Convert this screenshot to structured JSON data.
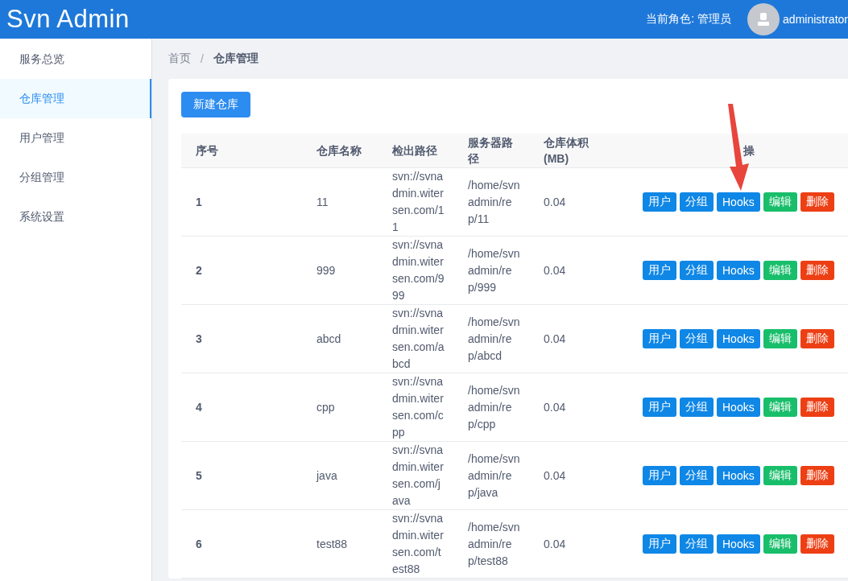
{
  "header": {
    "logo": "Svn Admin",
    "role_label": "当前角色:",
    "role": "管理员",
    "username": "administrator"
  },
  "sidebar": {
    "items": [
      {
        "label": "服务总览",
        "selected": false
      },
      {
        "label": "仓库管理",
        "selected": true
      },
      {
        "label": "用户管理",
        "selected": false
      },
      {
        "label": "分组管理",
        "selected": false
      },
      {
        "label": "系统设置",
        "selected": false
      }
    ]
  },
  "breadcrumb": [
    "首页",
    "/",
    "仓库管理"
  ],
  "new_button": "新建仓库",
  "table": {
    "columns": [
      "序号",
      "仓库名称",
      "检出路径",
      "服务器路径",
      "仓库体积 (MB)",
      "操"
    ],
    "rows": [
      {
        "index": "1",
        "name": "11",
        "checkout": "svn://svnadmin.witersen.com/11",
        "server_path": "/home/svnadmin/rep/11",
        "size": "0.04",
        "actions": [
          {
            "label": "用户",
            "kind": "primary"
          },
          {
            "label": "分组",
            "kind": "primary"
          },
          {
            "label": "Hooks",
            "kind": "primary"
          },
          {
            "label": "编辑",
            "kind": "success"
          },
          {
            "label": "删除",
            "kind": "danger"
          }
        ]
      },
      {
        "index": "2",
        "name": "999",
        "checkout": "svn://svnadmin.witersen.com/999",
        "server_path": "/home/svnadmin/rep/999",
        "size": "0.04",
        "actions": [
          {
            "label": "用户",
            "kind": "primary"
          },
          {
            "label": "分组",
            "kind": "primary"
          },
          {
            "label": "Hooks",
            "kind": "primary"
          },
          {
            "label": "编辑",
            "kind": "success"
          },
          {
            "label": "删除",
            "kind": "danger"
          }
        ]
      },
      {
        "index": "3",
        "name": "abcd",
        "checkout": "svn://svnadmin.witersen.com/abcd",
        "server_path": "/home/svnadmin/rep/abcd",
        "size": "0.04",
        "actions": [
          {
            "label": "用户",
            "kind": "primary"
          },
          {
            "label": "分组",
            "kind": "primary"
          },
          {
            "label": "Hooks",
            "kind": "primary"
          },
          {
            "label": "编辑",
            "kind": "success"
          },
          {
            "label": "删除",
            "kind": "danger"
          }
        ]
      },
      {
        "index": "4",
        "name": "cpp",
        "checkout": "svn://svnadmin.witersen.com/cpp",
        "server_path": "/home/svnadmin/rep/cpp",
        "size": "0.04",
        "actions": [
          {
            "label": "用户",
            "kind": "primary"
          },
          {
            "label": "分组",
            "kind": "primary"
          },
          {
            "label": "Hooks",
            "kind": "primary"
          },
          {
            "label": "编辑",
            "kind": "success"
          },
          {
            "label": "删除",
            "kind": "danger"
          }
        ]
      },
      {
        "index": "5",
        "name": "java",
        "checkout": "svn://svnadmin.witersen.com/java",
        "server_path": "/home/svnadmin/rep/java",
        "size": "0.04",
        "actions": [
          {
            "label": "用户",
            "kind": "primary"
          },
          {
            "label": "分组",
            "kind": "primary"
          },
          {
            "label": "Hooks",
            "kind": "primary"
          },
          {
            "label": "编辑",
            "kind": "success"
          },
          {
            "label": "删除",
            "kind": "danger"
          }
        ]
      },
      {
        "index": "6",
        "name": "test88",
        "checkout": "svn://svnadmin.witersen.com/test88",
        "server_path": "/home/svnadmin/rep/test88",
        "size": "0.04",
        "actions": [
          {
            "label": "用户",
            "kind": "primary"
          },
          {
            "label": "分组",
            "kind": "primary"
          },
          {
            "label": "Hooks",
            "kind": "primary"
          },
          {
            "label": "编辑",
            "kind": "success"
          },
          {
            "label": "删除",
            "kind": "danger"
          }
        ]
      }
    ]
  }
}
